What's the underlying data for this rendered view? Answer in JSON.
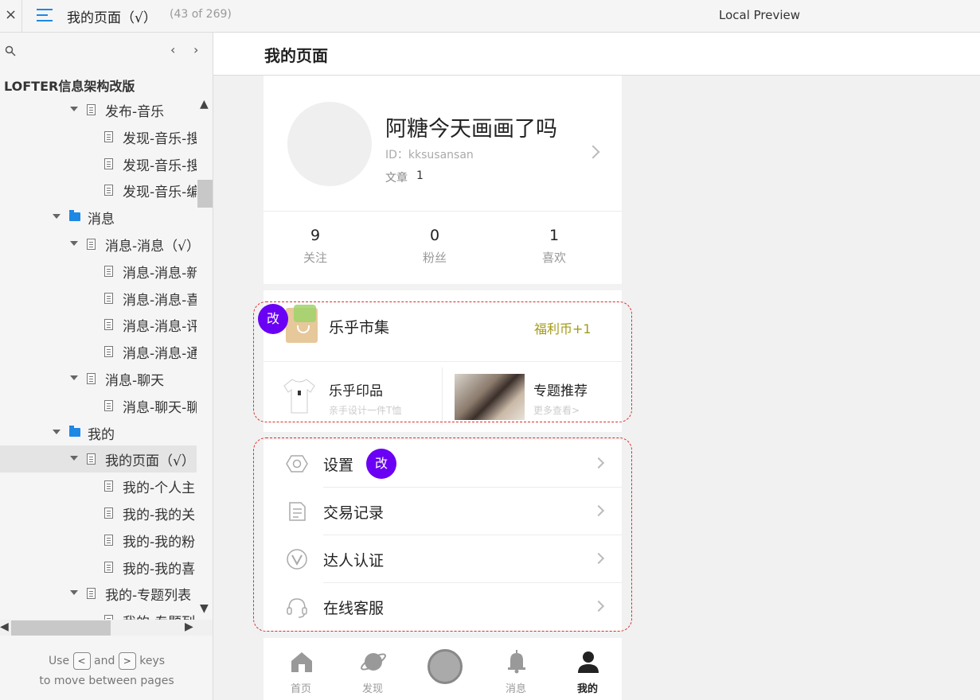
{
  "topbar": {
    "close_glyph": "×",
    "menu_icon": "menu-icon",
    "page_title": "我的页面（√）",
    "page_count": "(43 of 269)",
    "preview_label": "Local Preview"
  },
  "sidebar": {
    "search_icon": "search-icon",
    "prev_glyph": "‹",
    "next_glyph": "›",
    "project_title": "LOFTER信息架构改版",
    "items": [
      {
        "label": "发布-音乐",
        "kind": "page",
        "expanded": true
      },
      {
        "label": "发现-音乐-搜",
        "kind": "page"
      },
      {
        "label": "发现-音乐-搜",
        "kind": "page"
      },
      {
        "label": "发现-音乐-编",
        "kind": "page"
      },
      {
        "label": "消息",
        "kind": "folder",
        "expanded": true
      },
      {
        "label": "消息-消息（√）",
        "kind": "page",
        "expanded": true
      },
      {
        "label": "消息-消息-新",
        "kind": "page"
      },
      {
        "label": "消息-消息-喜",
        "kind": "page"
      },
      {
        "label": "消息-消息-评",
        "kind": "page"
      },
      {
        "label": "消息-消息-通",
        "kind": "page"
      },
      {
        "label": "消息-聊天",
        "kind": "page",
        "expanded": true
      },
      {
        "label": "消息-聊天-聊",
        "kind": "page"
      },
      {
        "label": "我的",
        "kind": "folder",
        "expanded": true
      },
      {
        "label": "我的页面（√）",
        "kind": "page",
        "expanded": true,
        "selected": true
      },
      {
        "label": "我的-个人主",
        "kind": "page"
      },
      {
        "label": "我的-我的关",
        "kind": "page"
      },
      {
        "label": "我的-我的粉",
        "kind": "page"
      },
      {
        "label": "我的-我的喜",
        "kind": "page"
      },
      {
        "label": "我的-专题列表",
        "kind": "page",
        "expanded": true
      },
      {
        "label": "我的-专题列",
        "kind": "page"
      }
    ],
    "hint": {
      "use": "Use",
      "key_left": "<",
      "and": "and",
      "key_right": ">",
      "keys": "keys",
      "line2": "to move between pages"
    }
  },
  "main": {
    "title": "我的页面"
  },
  "profile": {
    "username": "阿糖今天画画了吗",
    "user_id": "ID：kksusansan",
    "articles_label": "文章",
    "articles_value": "1",
    "stats": [
      {
        "value": "9",
        "label": "关注"
      },
      {
        "value": "0",
        "label": "粉丝"
      },
      {
        "value": "1",
        "label": "喜欢"
      }
    ]
  },
  "market": {
    "title": "乐乎市集",
    "reward": "福利币+1",
    "badge": "改",
    "yinpin_title": "乐乎印品",
    "yinpin_sub": "亲手设计一件T恤",
    "topic_title": "专题推荐",
    "topic_sub": "更多查看>"
  },
  "menu": {
    "badge": "改",
    "items": [
      {
        "label": "设置",
        "icon": "gear-icon"
      },
      {
        "label": "交易记录",
        "icon": "document-icon"
      },
      {
        "label": "达人认证",
        "icon": "verified-icon"
      },
      {
        "label": "在线客服",
        "icon": "headset-icon"
      }
    ]
  },
  "tabbar": {
    "tabs": [
      {
        "label": "首页",
        "icon": "home-icon"
      },
      {
        "label": "发现",
        "icon": "planet-icon"
      },
      {
        "label": "",
        "icon": "publish-icon"
      },
      {
        "label": "消息",
        "icon": "bell-icon"
      },
      {
        "label": "我的",
        "icon": "user-icon",
        "active": true
      }
    ]
  },
  "colors": {
    "accent": "#1e88e5",
    "badge": "#6a00f4",
    "annotation_border": "#e02b2b",
    "reward_text": "#a39a17"
  }
}
